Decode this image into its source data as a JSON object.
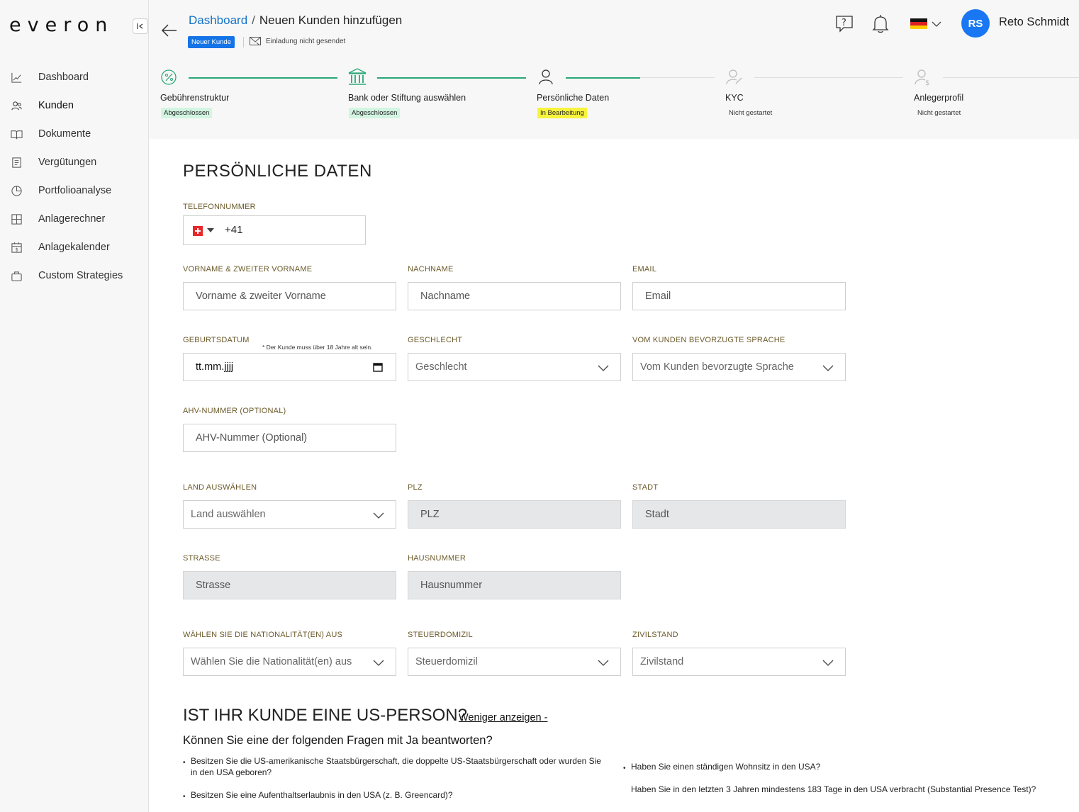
{
  "app": {
    "logo": "everon",
    "collapse_icon": "collapse-left-icon"
  },
  "sidebar": {
    "items": [
      {
        "label": "Dashboard",
        "icon": "chart-line-icon"
      },
      {
        "label": "Kunden",
        "icon": "users-icon"
      },
      {
        "label": "Dokumente",
        "icon": "book-icon"
      },
      {
        "label": "Vergütungen",
        "icon": "receipt-icon"
      },
      {
        "label": "Portfolioanalyse",
        "icon": "pie-chart-icon"
      },
      {
        "label": "Anlagerechner",
        "icon": "calculator-icon"
      },
      {
        "label": "Anlagekalender",
        "icon": "calendar-dollar-icon"
      },
      {
        "label": "Custom Strategies",
        "icon": "briefcase-icon"
      }
    ]
  },
  "header": {
    "breadcrumb_root": "Dashboard",
    "breadcrumb_separator": "/",
    "breadcrumb_current": "Neuen Kunden hinzufügen",
    "tag": "Neuer Kunde",
    "invite_status": "Einladung nicht gesendet",
    "user_initials": "RS",
    "user_name": "Reto Schmidt",
    "language_flag": "de-flag-icon"
  },
  "stepper": {
    "steps": [
      {
        "label": "Gebührenstruktur",
        "status": "Abgeschlossen"
      },
      {
        "label": "Bank oder Stiftung auswählen",
        "status": "Abgeschlossen"
      },
      {
        "label": "Persönliche Daten",
        "status": "In Bearbeitung"
      },
      {
        "label": "KYC",
        "status": "Nicht gestartet"
      },
      {
        "label": "Anlegerprofil",
        "status": "Nicht gestartet"
      }
    ],
    "colors": {
      "done": "#2aa876",
      "pending": "#dddddd"
    }
  },
  "form": {
    "title": "PERSÖNLICHE DATEN",
    "phone": {
      "label": "TELEFONNUMMER",
      "value": "+41"
    },
    "first_name": {
      "label": "VORNAME & ZWEITER VORNAME",
      "placeholder": "Vorname & zweiter Vorname"
    },
    "last_name": {
      "label": "NACHNAME",
      "placeholder": "Nachname"
    },
    "email": {
      "label": "EMAIL",
      "placeholder": "Email"
    },
    "birthdate": {
      "label": "GEBURTSDATUM",
      "hint": "* Der Kunde muss über 18 Jahre alt sein.",
      "value": "tt.mm.jjjj"
    },
    "gender": {
      "label": "GESCHLECHT",
      "placeholder": "Geschlecht"
    },
    "language": {
      "label": "VOM KUNDEN BEVORZUGTE SPRACHE",
      "placeholder": "Vom Kunden bevorzugte Sprache"
    },
    "ahv": {
      "label": "AHV-NUMMER (OPTIONAL)",
      "placeholder": "AHV-Nummer (Optional)"
    },
    "country": {
      "label": "LAND AUSWÄHLEN",
      "placeholder": "Land auswählen"
    },
    "zip": {
      "label": "PLZ",
      "placeholder": "PLZ"
    },
    "city": {
      "label": "STADT",
      "placeholder": "Stadt"
    },
    "street": {
      "label": "STRASSE",
      "placeholder": "Strasse"
    },
    "house_number": {
      "label": "HAUSNUMMER",
      "placeholder": "Hausnummer"
    },
    "nationality": {
      "label": "WÄHLEN SIE DIE NATIONALITÄT(EN) AUS",
      "placeholder": "Wählen Sie die Nationalität(en) aus"
    },
    "tax_domicile": {
      "label": "STEUERDOMIZIL",
      "placeholder": "Steuerdomizil"
    },
    "civil_status": {
      "label": "ZIVILSTAND",
      "placeholder": "Zivilstand"
    }
  },
  "us_person": {
    "title": "IST IHR KUNDE EINE US-PERSON?",
    "toggle": "Weniger anzeigen -",
    "question": "Können Sie eine der folgenden Fragen mit Ja beantworten?",
    "items": [
      "Besitzen Sie die US-amerikanische Staatsbürgerschaft, die doppelte US-Staatsbürgerschaft oder wurden Sie in den USA geboren?",
      "Haben Sie einen ständigen Wohnsitz in den USA?",
      "Besitzen Sie eine Aufenthaltserlaubnis in den USA (z. B. Greencard)?",
      "Haben Sie in den letzten 3 Jahren mindestens 183 Tage in den USA verbracht (Substantial Presence Test)?"
    ]
  }
}
